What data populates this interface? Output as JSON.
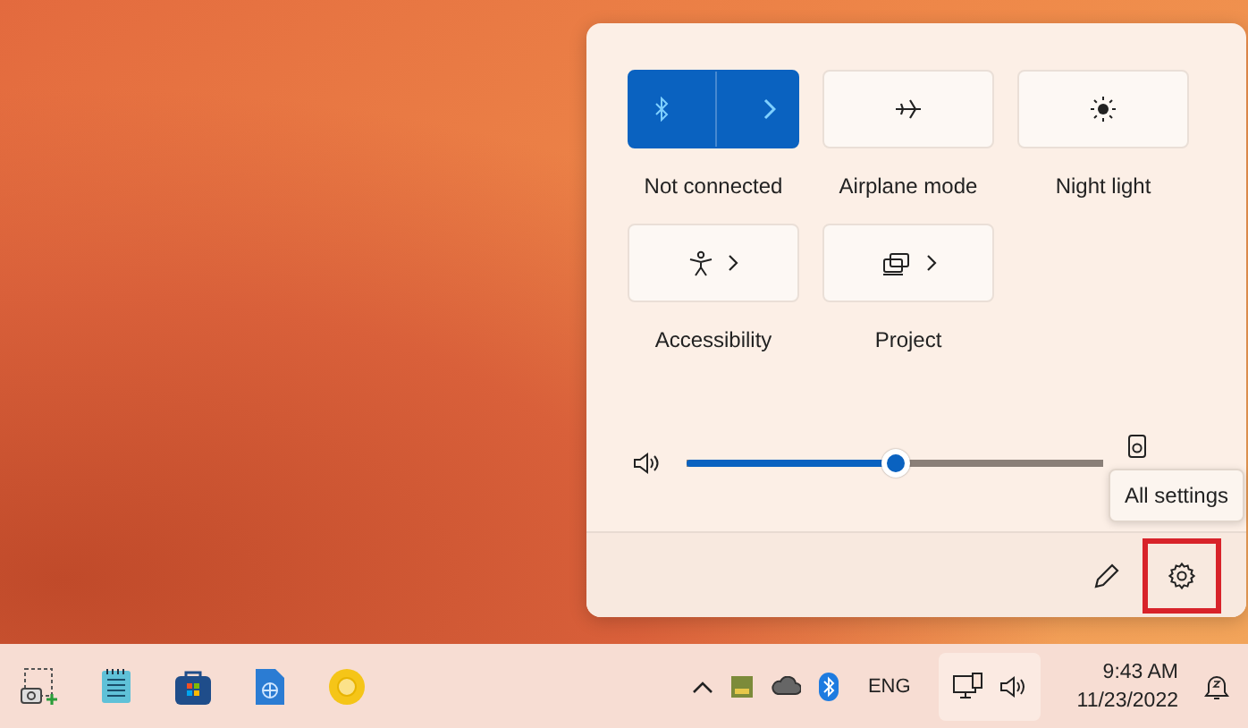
{
  "quick_settings": {
    "tiles": [
      {
        "kind": "split",
        "label": "Not connected",
        "on": true
      },
      {
        "kind": "toggle",
        "label": "Airplane mode",
        "on": false
      },
      {
        "kind": "toggle",
        "label": "Night light",
        "on": false
      },
      {
        "kind": "expand",
        "label": "Accessibility"
      },
      {
        "kind": "expand",
        "label": "Project"
      }
    ],
    "volume": {
      "level": 0.5
    },
    "settings_highlighted": true,
    "tooltip": "All settings"
  },
  "taskbar": {
    "tray": {
      "language": "ENG",
      "time": "9:43 AM",
      "date": "11/23/2022",
      "quick_settings_hovered": true
    }
  }
}
